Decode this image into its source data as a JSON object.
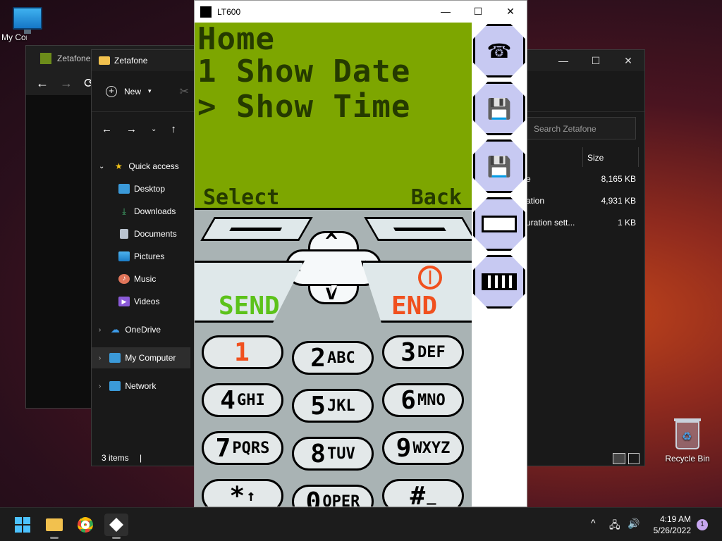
{
  "desktop": {
    "icons": [
      {
        "label": "My Computer"
      },
      {
        "label": "Recycle Bin"
      }
    ]
  },
  "back_window": {
    "title": "Zetafone"
  },
  "explorer": {
    "title": "Zetafone",
    "new_label": "New",
    "search_placeholder": "Search Zetafone",
    "column_size": "Size",
    "nav": [
      {
        "label": "Quick access"
      },
      {
        "label": "Desktop"
      },
      {
        "label": "Downloads"
      },
      {
        "label": "Documents"
      },
      {
        "label": "Pictures"
      },
      {
        "label": "Music"
      },
      {
        "label": "Videos"
      },
      {
        "label": "OneDrive"
      },
      {
        "label": "My Computer"
      },
      {
        "label": "Network"
      }
    ],
    "files": [
      {
        "name": "e",
        "size": "8,165 KB"
      },
      {
        "name": "ation",
        "size": "4,931 KB"
      },
      {
        "name": "uration sett...",
        "size": "1 KB"
      }
    ],
    "status": "3 items"
  },
  "emulator": {
    "title": "LT600",
    "lcd": {
      "line1": "Home",
      "line2": "1 Show Date",
      "line3": "> Show Time",
      "left_soft": "Select",
      "right_soft": "Back"
    },
    "call_keys": {
      "send": "SEND",
      "end": "END"
    },
    "keypad": [
      {
        "digit": "1",
        "letters": ""
      },
      {
        "digit": "2",
        "letters": "ABC"
      },
      {
        "digit": "3",
        "letters": "DEF"
      },
      {
        "digit": "4",
        "letters": "GHI"
      },
      {
        "digit": "5",
        "letters": "JKL"
      },
      {
        "digit": "6",
        "letters": "MNO"
      },
      {
        "digit": "7",
        "letters": "PQRS"
      },
      {
        "digit": "8",
        "letters": "TUV"
      },
      {
        "digit": "9",
        "letters": "WXYZ"
      },
      {
        "digit": "*",
        "letters": "↑"
      },
      {
        "digit": "0",
        "letters": "OPER"
      },
      {
        "digit": "#",
        "letters": "_"
      }
    ],
    "colors": {
      "lcd": "#7da600",
      "send": "#5cc21a",
      "end": "#f0501e",
      "side": "#c7c9f2"
    }
  },
  "taskbar": {
    "time": "4:19 AM",
    "date": "5/26/2022",
    "notification_count": "1"
  }
}
